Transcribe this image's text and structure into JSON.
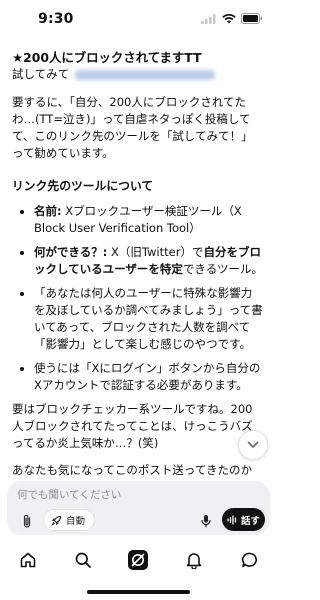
{
  "status": {
    "time": "9:30"
  },
  "message": {
    "heading": "★200人にブロックされてますTT",
    "try_prefix": "試してみて",
    "para1": "要するに、「自分、200人にブロックされてたわ…(TT=泣き)」って自虐ネタっぽく投稿してて、このリンク先のツールを「試してみて！」って勧めています。",
    "section_title": "リンク先のツールについて",
    "bullets": [
      {
        "bold": "名前:",
        "text": " Xブロックユーザー検証ツール（X Block User Verification Tool）"
      },
      {
        "bold": "何ができる？:",
        "text": " X（旧Twitter）で",
        "bold2": "自分をブロックしているユーザーを特定",
        "text2": "できるツール。"
      },
      {
        "text": "「あなたは何人のユーザーに特殊な影響力を及ぼしているか調べてみましょう」って書いてあって、ブロックされた人数を調べて「影響力」として楽しむ感じのやつです。"
      },
      {
        "text": "使うには「Xにログイン」ボタンから自分のXアカウントで認証する必要があります。"
      }
    ],
    "para2": "要はブロックチェッカー系ツールですね。200人ブロックされてたってことは、けっこうバズってるか炎上気味か…？(笑)",
    "para3": "あなたも気になってこのポスト送ってきたのかな？試してみたい？ それともただのネタ共有？"
  },
  "composer": {
    "placeholder": "何でも聞いてください",
    "auto_label": "自動",
    "talk_label": "話す"
  },
  "tabs": [
    "home",
    "search",
    "grok",
    "notifications",
    "messages"
  ],
  "colors": {
    "background": "#ffffff",
    "text": "#111111",
    "composer_bg": "#f0f0f2",
    "talk_button": "#111111"
  }
}
